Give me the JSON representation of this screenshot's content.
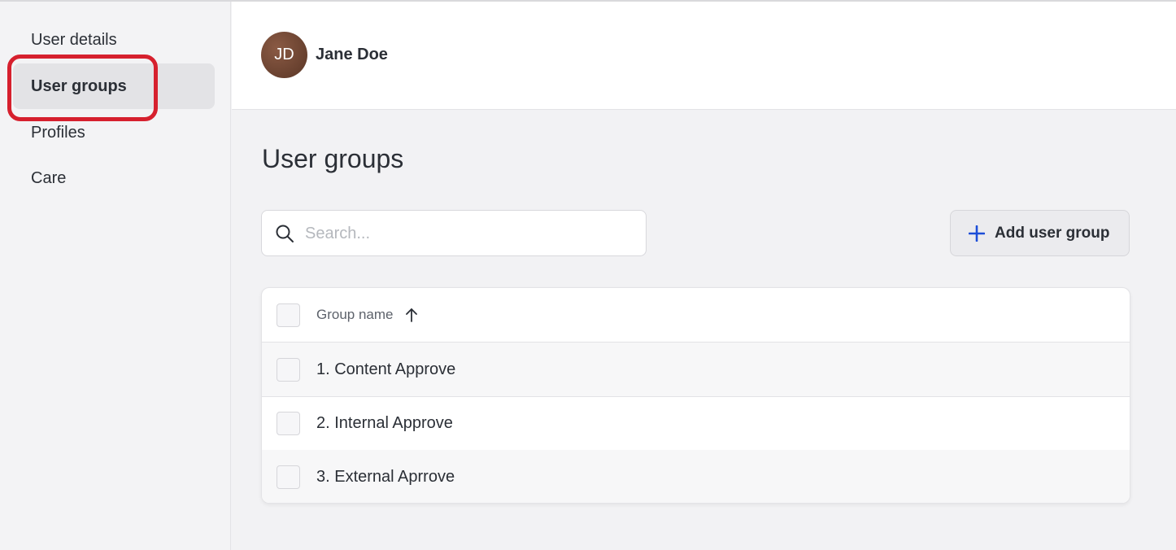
{
  "sidebar": {
    "items": [
      {
        "label": "User details"
      },
      {
        "label": "User groups"
      },
      {
        "label": "Profiles"
      },
      {
        "label": "Care"
      }
    ]
  },
  "header": {
    "avatar_initials": "JD",
    "user_name": "Jane Doe"
  },
  "main": {
    "title": "User groups",
    "search": {
      "placeholder": "Search...",
      "value": ""
    },
    "add_button_label": "Add user group",
    "table": {
      "columns": [
        {
          "label": "Group name",
          "sort": "ascending",
          "sort_icon": "arrow-up-icon"
        }
      ],
      "rows": [
        {
          "name": "1. Content Approve"
        },
        {
          "name": "2. Internal Approve"
        },
        {
          "name": "3. External Aprrove"
        }
      ]
    }
  },
  "colors": {
    "highlight": "#d6202e",
    "accent": "#1d4ed8",
    "active_nav_bg": "#e3e3e6"
  }
}
